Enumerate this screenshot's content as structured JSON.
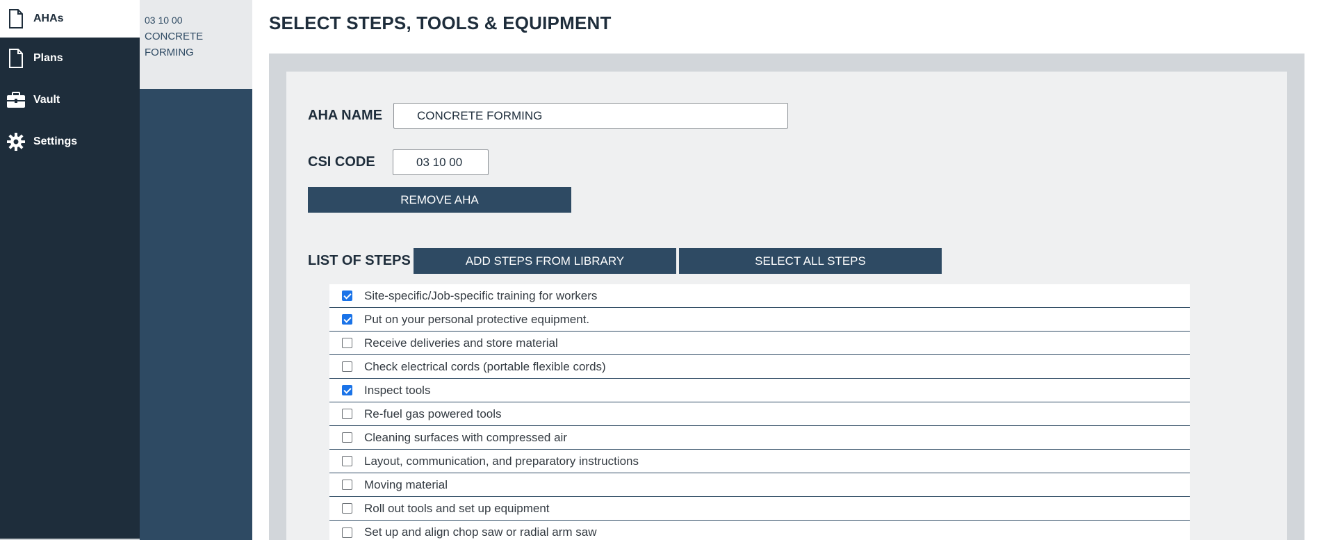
{
  "nav": {
    "items": [
      {
        "label": "AHAs",
        "icon": "document-icon",
        "active": true
      },
      {
        "label": "Plans",
        "icon": "document-icon",
        "active": false
      },
      {
        "label": "Vault",
        "icon": "briefcase-icon",
        "active": false
      },
      {
        "label": "Settings",
        "icon": "gear-icon",
        "active": false
      }
    ]
  },
  "aha_list": {
    "items": [
      {
        "code": "03 10 00",
        "name_line1": "CONCRETE",
        "name_line2": "FORMING"
      }
    ]
  },
  "page": {
    "title": "SELECT STEPS, TOOLS & EQUIPMENT"
  },
  "form": {
    "aha_name_label": "AHA NAME",
    "aha_name_value": "CONCRETE FORMING",
    "csi_code_label": "CSI CODE",
    "csi_code_value": "03 10 00",
    "remove_button": "REMOVE AHA",
    "steps_label": "LIST OF STEPS",
    "add_steps_button": "ADD STEPS FROM LIBRARY",
    "select_all_button": "SELECT ALL STEPS"
  },
  "steps": [
    {
      "label": "Site-specific/Job-specific training for workers",
      "checked": true
    },
    {
      "label": "Put on your personal protective equipment.",
      "checked": true
    },
    {
      "label": "Receive deliveries and store material",
      "checked": false
    },
    {
      "label": "Check electrical cords (portable flexible cords)",
      "checked": false
    },
    {
      "label": "Inspect tools",
      "checked": true
    },
    {
      "label": "Re-fuel gas powered tools",
      "checked": false
    },
    {
      "label": "Cleaning surfaces with compressed air",
      "checked": false
    },
    {
      "label": "Layout, communication, and preparatory instructions",
      "checked": false
    },
    {
      "label": "Moving material",
      "checked": false
    },
    {
      "label": "Roll out tools and set up equipment",
      "checked": false
    },
    {
      "label": "Set up and align chop saw or radial arm saw",
      "checked": false
    }
  ],
  "colors": {
    "nav_bg": "#1e2d3b",
    "accent": "#2e4a63",
    "checkbox_checked": "#1a73e8"
  }
}
